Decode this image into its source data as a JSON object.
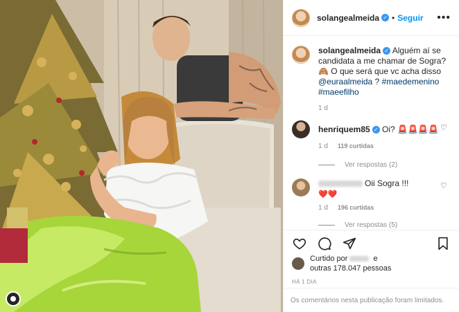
{
  "post": {
    "username": "solangealmeida",
    "follow_label": "Seguir",
    "more_label": "•••",
    "dot": "•"
  },
  "caption": {
    "username": "solangealmeida",
    "text_1": " Alguém aí se candidata a me chamar de Sogra? 🙈 O que será que vc acha disso ",
    "mention": "@euraalmeida",
    "text_2": " ? ",
    "tag_1": "#maedemenino",
    "tag_2": "#maeefilho",
    "age": "1 d"
  },
  "comments": [
    {
      "username": "henriquem85",
      "text": " Oi? 🚨🚨🚨🚨",
      "age": "1 d",
      "likes": "119 curtidas",
      "replies": "Ver respostas (2)"
    },
    {
      "username": "",
      "text": "Oii Sogra !!!",
      "text_2": "❤️❤️",
      "age": "1 d",
      "likes": "196 curtidas",
      "replies": "Ver respostas (5)"
    }
  ],
  "likes": {
    "prefix": "Curtido por",
    "conjunction": "e",
    "others": "outras 178.047 pessoas"
  },
  "timestamp": "HÁ 1 DIA",
  "comments_limited": "Os comentários nesta publicação foram limitados.",
  "icons": [
    "heart-icon",
    "comment-icon",
    "share-icon",
    "bookmark-icon"
  ],
  "colors": {
    "follow": "#0095f6",
    "verified": "#3897f0",
    "muted": "#8e8e8e",
    "skirt": "#a6d63a"
  }
}
